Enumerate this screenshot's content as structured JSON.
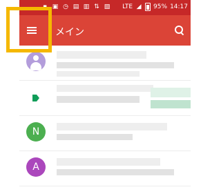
{
  "statusbar": {
    "icons": [
      "notification-icon",
      "image-icon",
      "alarm-icon",
      "contact-icon",
      "lock-icon",
      "data-icon",
      "nfc-icon",
      "lte-icon",
      "signal-icon",
      "battery-icon"
    ],
    "lte": "LTE",
    "battery": "95%",
    "time": "14:17"
  },
  "appbar": {
    "title": "メイン",
    "menu_icon": "hamburger-menu-icon",
    "search_icon": "search-icon"
  },
  "list": {
    "avatars": [
      "",
      "",
      "N",
      "A"
    ]
  },
  "colors": {
    "statusbar": "#c62828",
    "appbar": "#db4437",
    "highlight_frame": "#f5b800",
    "avatar_n": "#4caf50",
    "avatar_a": "#ab47bc",
    "tag": "#0f9d58"
  }
}
